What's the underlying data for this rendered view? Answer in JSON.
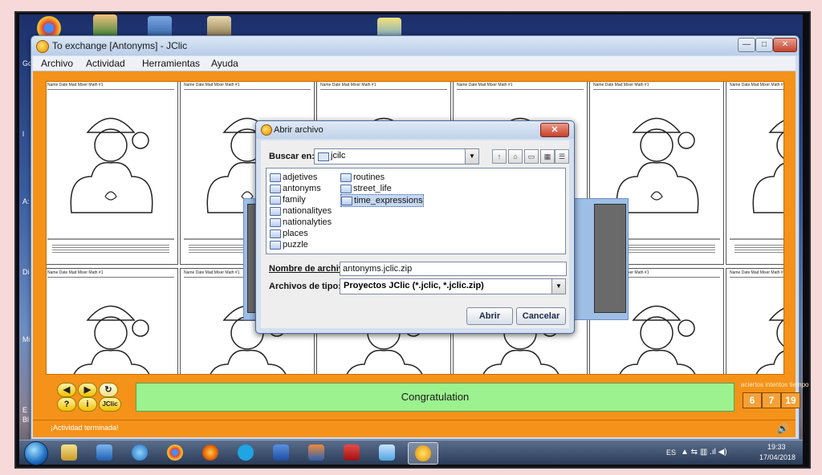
{
  "desktop": {
    "side_labels": [
      "Gc",
      "l",
      "A:",
      "Di",
      "Mi",
      "E",
      "Bl"
    ]
  },
  "window": {
    "title": "To exchange [Antonyms] - JClic",
    "controls": [
      "—",
      "□",
      "✕"
    ]
  },
  "menubar": {
    "items": [
      "Archivo",
      "Actividad",
      "Herramientas",
      "Ayuda"
    ]
  },
  "worksheet": {
    "header_name": "Name",
    "header_date": "Date",
    "header_title": "Mad Mixer Math #1",
    "directions": "Directions: Add the math problems. Color by the code based upon the sums."
  },
  "controls": {
    "message": "Congratulation",
    "counter_labels": "aciertos  intentos  tiempo",
    "aciertos": "6",
    "intentos": "7",
    "tiempo": "19",
    "jclic_label": "JClic"
  },
  "status": {
    "text": "¡Actividad terminada!"
  },
  "dialog": {
    "title": "Abrir archivo",
    "buscar_label": "Buscar en:",
    "buscar_value": "jcilc",
    "files_col1": [
      "adjetives",
      "antonyms",
      "family",
      "nationalityes",
      "nationalyties",
      "places",
      "puzzle"
    ],
    "files_col2": [
      "routines",
      "street_life",
      "time_expressions"
    ],
    "selected_file": "time_expressions",
    "nombre_label": "Nombre de archivo:",
    "nombre_value": "antonyms.jclic.zip",
    "tipo_label": "Archivos de tipo:",
    "tipo_value": "Proyectos JClic (*.jclic, *.jclic.zip)",
    "open_button": "Abrir",
    "cancel_button": "Cancelar"
  },
  "taskbar": {
    "lang": "ES",
    "time": "19:33",
    "date": "17/04/2018"
  }
}
